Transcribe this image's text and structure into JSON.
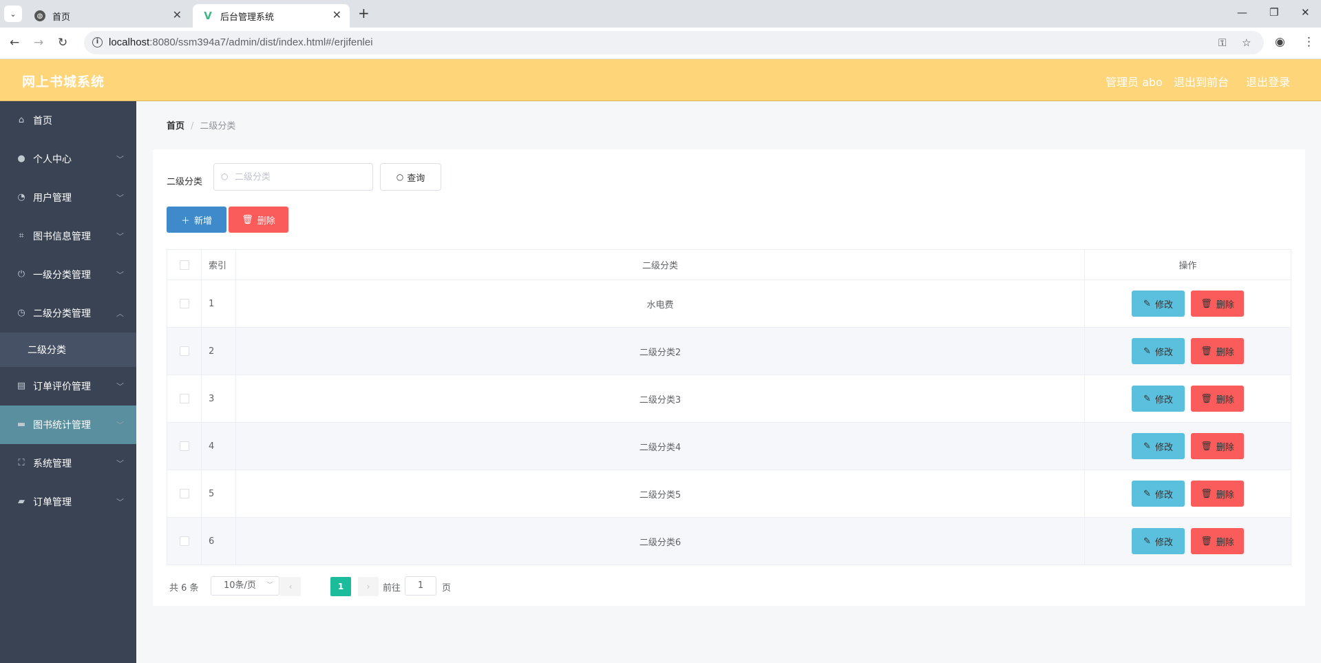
{
  "browser": {
    "tabs": [
      {
        "title": "首页",
        "active": false
      },
      {
        "title": "后台管理系统",
        "active": true
      }
    ],
    "url_host": "localhost",
    "url_path": ":8080/ssm394a7/admin/dist/index.html#/erjifenlei"
  },
  "header": {
    "title": "网上书城系统",
    "user": "管理员 abo",
    "front_link": "退出到前台",
    "logout_link": "退出登录"
  },
  "sidebar": {
    "items": [
      {
        "label": "首页",
        "icon": "home-icon"
      },
      {
        "label": "个人中心",
        "icon": "user-icon"
      },
      {
        "label": "用户管理",
        "icon": "speedometer-icon"
      },
      {
        "label": "图书信息管理",
        "icon": "crop-icon"
      },
      {
        "label": "一级分类管理",
        "icon": "power-icon"
      },
      {
        "label": "二级分类管理",
        "icon": "compass-icon"
      },
      {
        "label": "二级分类",
        "icon": ""
      },
      {
        "label": "订单评价管理",
        "icon": "clipboard-icon"
      },
      {
        "label": "图书统计管理",
        "icon": "box-icon"
      },
      {
        "label": "系统管理",
        "icon": "fullscreen-icon"
      },
      {
        "label": "订单管理",
        "icon": "briefcase-icon"
      }
    ]
  },
  "breadcrumb": {
    "home": "首页",
    "current": "二级分类"
  },
  "search": {
    "label": "二级分类",
    "placeholder": "二级分类",
    "query_button": "查询"
  },
  "actions": {
    "add": "新增",
    "delete": "删除"
  },
  "table": {
    "columns": [
      "索引",
      "二级分类",
      "操作"
    ],
    "rows": [
      {
        "index": "1",
        "name": "水电费"
      },
      {
        "index": "2",
        "name": "二级分类2"
      },
      {
        "index": "3",
        "name": "二级分类3"
      },
      {
        "index": "4",
        "name": "二级分类4"
      },
      {
        "index": "5",
        "name": "二级分类5"
      },
      {
        "index": "6",
        "name": "二级分类6"
      }
    ],
    "edit_label": "修改",
    "delete_label": "删除"
  },
  "pagination": {
    "total": "共 6 条",
    "page_size": "10条/页",
    "current_page": "1",
    "goto_label": "前往",
    "goto_value": "1",
    "page_suffix": "页"
  },
  "colors": {
    "header_bg": "#ffd57a",
    "sidebar_bg": "#3a4354",
    "primary": "#3f8acb",
    "danger": "#fa5c5c",
    "info": "#5bc0de",
    "pager_active": "#1abc9c"
  }
}
